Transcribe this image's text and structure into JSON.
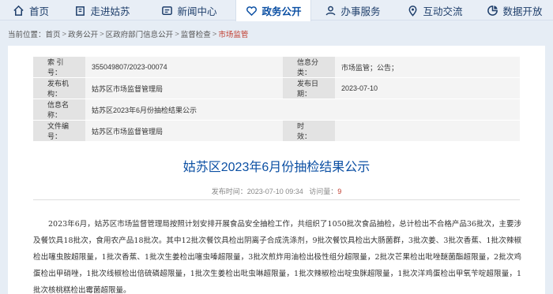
{
  "nav": {
    "items": [
      {
        "label": "首页",
        "icon": "home-icon"
      },
      {
        "label": "走进姑苏",
        "icon": "building-icon"
      },
      {
        "label": "新闻中心",
        "icon": "news-icon"
      },
      {
        "label": "政务公开",
        "icon": "heart-icon",
        "active": true
      },
      {
        "label": "办事服务",
        "icon": "service-icon"
      },
      {
        "label": "互动交流",
        "icon": "location-icon"
      },
      {
        "label": "数据开放",
        "icon": "data-icon"
      }
    ]
  },
  "breadcrumb": {
    "prefix": "当前位置：",
    "items": [
      "首页",
      "政务公开",
      "区政府部门信息公开",
      "监督检查",
      "市场监管"
    ],
    "separator": ">"
  },
  "info": {
    "index_label": "索  引  号：",
    "index_value": "355049807/2023-00074",
    "category_label": "信息分类：",
    "category_value": "市场监管；公告；",
    "org_label": "发布机构：",
    "org_value": "姑苏区市场监督管理局",
    "date_label": "发布日期：",
    "date_value": "2023-07-10",
    "name_label": "信息名称：",
    "name_value": "姑苏区2023年6月份抽检结果公示",
    "doc_label": "文件编号：",
    "doc_value": "姑苏区市场监督管理局",
    "effect_label": "时　　效：",
    "effect_value": ""
  },
  "article": {
    "title": "姑苏区2023年6月份抽检结果公示",
    "time_label": "发布时间：",
    "time_value": "2023-07-10 09:34",
    "hits_label": "访问量：",
    "hits_value": "9",
    "body": "2023年6月，姑苏区市场监督管理局按照计划安排开展食品安全抽检工作，共组织了1050批次食品抽检，总计检出不合格产品36批次，主要涉及餐饮具18批次，食用农产品18批次。其中12批次餐饮具检出阴离子合成洗涤剂，9批次餐饮具检出大肠菌群，3批次姜、3批次香蕉、1批次辣椒检出噻虫胺超限量，1批次香蕉、1批次生姜检出噻虫嗪超限量，3批次煎炸用油检出极性组分超限量，2批次芒果检出吡唑醚菌酯超限量，2批次鸡蛋检出甲硝唑，1批次线椒检出倍硫磷超限量，1批次生姜检出吡虫啉超限量，1批次辣椒检出啶虫脒超限量，1批次洋鸡蛋检出甲氧苄啶超限量，1批次核桃糕检出霉菌超限量。"
  }
}
